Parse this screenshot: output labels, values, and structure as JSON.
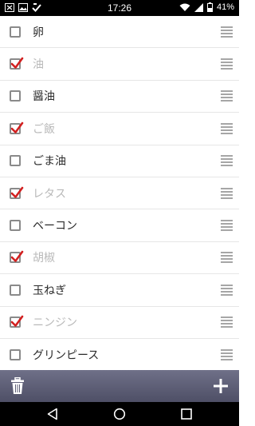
{
  "status_bar": {
    "time": "17:26",
    "battery": "41%",
    "icons": [
      "notification-x-icon",
      "image-icon",
      "download-check-icon",
      "wifi-icon",
      "signal-icon",
      "battery-icon"
    ]
  },
  "items": [
    {
      "label": "卵",
      "checked": false
    },
    {
      "label": "油",
      "checked": true
    },
    {
      "label": "醤油",
      "checked": false
    },
    {
      "label": "ご飯",
      "checked": true
    },
    {
      "label": "ごま油",
      "checked": false
    },
    {
      "label": "レタス",
      "checked": true
    },
    {
      "label": "ベーコン",
      "checked": false
    },
    {
      "label": "胡椒",
      "checked": true
    },
    {
      "label": "玉ねぎ",
      "checked": false
    },
    {
      "label": "ニンジン",
      "checked": true
    },
    {
      "label": "グリンピース",
      "checked": false
    }
  ],
  "action_bar": {
    "left_icon": "trash-icon",
    "right_icon": "plus-icon"
  },
  "nav_bar": {
    "icons": [
      "back-icon",
      "home-icon",
      "recents-icon"
    ]
  },
  "colors": {
    "check_mark": "#d32020",
    "done_text": "#b9b9b9",
    "text": "#2b2b2b",
    "action_bar": "#5d5e75"
  }
}
